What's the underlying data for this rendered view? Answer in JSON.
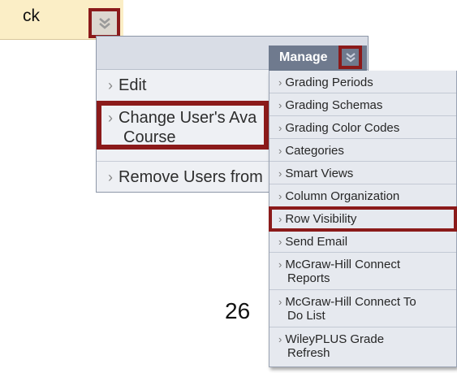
{
  "header": {
    "text": "ck",
    "chevron_icon": "double-chevron-down-icon"
  },
  "context_menu": {
    "items": [
      {
        "label": "Edit"
      },
      {
        "label_line1": "Change User's Ava",
        "label_line2": "Course"
      },
      {
        "label": "Remove Users from"
      }
    ],
    "arrow": "›"
  },
  "manage_menu": {
    "title": "Manage",
    "chevron_icon": "double-chevron-down-icon",
    "arrow": "›",
    "items": [
      {
        "label": "Grading Periods"
      },
      {
        "label": "Grading Schemas"
      },
      {
        "label": "Grading Color Codes"
      },
      {
        "label": "Categories"
      },
      {
        "label": "Smart Views"
      },
      {
        "label": "Column Organization"
      },
      {
        "label": "Row Visibility"
      },
      {
        "label": "Send Email"
      },
      {
        "label_line1": "McGraw-Hill Connect",
        "label_line2": "Reports"
      },
      {
        "label_line1": "McGraw-Hill Connect To",
        "label_line2": "Do List"
      },
      {
        "label_line1": "WileyPLUS Grade",
        "label_line2": "Refresh"
      }
    ]
  },
  "page_number": "26",
  "colors": {
    "highlight": "#8b1a1a",
    "manage_header_bg": "#6f7a8e",
    "menu_bg": "#e6e9ef",
    "header_bg": "#fbeec6"
  }
}
